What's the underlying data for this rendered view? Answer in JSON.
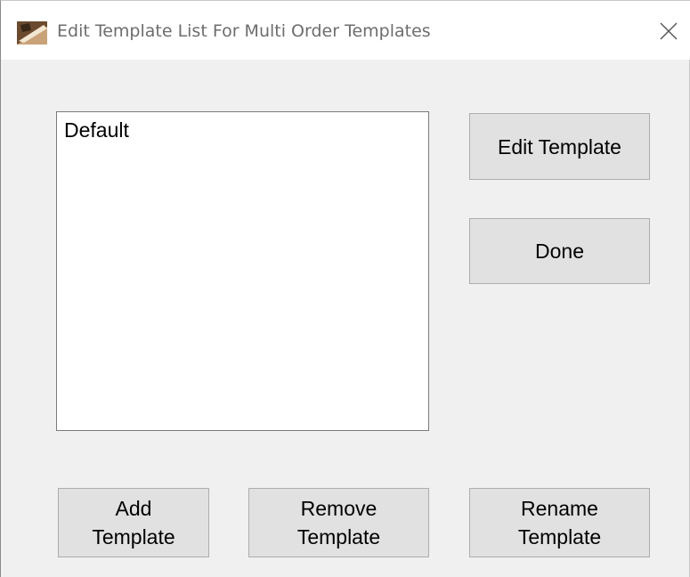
{
  "window": {
    "title": "Edit Template List For Multi Order Templates",
    "app_icon": "app-icon",
    "close_icon": "close-icon"
  },
  "template_list": {
    "items": [
      "Default"
    ]
  },
  "buttons": {
    "edit_template": "Edit Template",
    "done": "Done",
    "add_template": "Add\nTemplate",
    "remove_template": "Remove\nTemplate",
    "rename_template": "Rename\nTemplate"
  },
  "colors": {
    "title_bg": "#ffffff",
    "client_bg": "#f0f0f0",
    "button_bg": "#e1e1e1",
    "button_border": "#adadad",
    "list_bg": "#ffffff"
  }
}
